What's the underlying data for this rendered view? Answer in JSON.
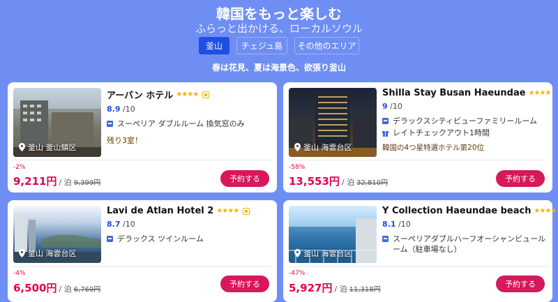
{
  "hero": {
    "title": "韓国をもっと楽しむ",
    "subtitle": "ふらっと出かける、ローカルソウル"
  },
  "tabs": [
    {
      "label": "釜山",
      "active": true
    },
    {
      "label": "チェジュ島",
      "active": false
    },
    {
      "label": "その他のエリア",
      "active": false
    }
  ],
  "tagline": "春は花見、夏は海景色、欲張り釜山",
  "colors": {
    "accent": "#1f4fe0",
    "price": "#e0004d",
    "button": "#d7185a",
    "background": "#6f8ef3",
    "star": "#f5b200"
  },
  "hotels": [
    {
      "name": "アーバン ホテル",
      "stars": "★★★★",
      "score": "8.9",
      "score_max": "/10",
      "location": "釜山 釜山鎮区",
      "features": [
        "スーペリア ダブルルーム 換気窓のみ"
      ],
      "feature_icons": [
        "bed-icon"
      ],
      "note": "残り3室！",
      "discount": "-2%",
      "price": "9,211円",
      "per_night": "/ 泊",
      "old_price": "9,399円",
      "book_label": "予約する"
    },
    {
      "name": "Shilla Stay Busan Haeundae",
      "stars": "★★★★",
      "score": "9",
      "score_max": "/10",
      "location": "釜山 海雲台区",
      "features": [
        "デラックスシティビューファミリールーム",
        "レイトチェックアウト1時間"
      ],
      "feature_icons": [
        "bed-icon",
        "gift-icon"
      ],
      "note": "韓国の4つ星特選ホテル第20位",
      "discount": "-58%",
      "price": "13,553円",
      "per_night": "/ 泊",
      "old_price": "32,810円",
      "book_label": "予約する"
    },
    {
      "name": "Lavi de Atlan Hotel 2",
      "stars": "★★★★",
      "score": "8.7",
      "score_max": "/10",
      "location": "釜山 海雲台区",
      "features": [
        "デラックス ツインルーム"
      ],
      "feature_icons": [
        "bed-icon"
      ],
      "note": "",
      "discount": "-4%",
      "price": "6,500円",
      "per_night": "/ 泊",
      "old_price": "6,769円",
      "book_label": "予約する"
    },
    {
      "name": "Y Collection Haeundae beach",
      "stars": "★★★★",
      "score": "8.1",
      "score_max": "/10",
      "location": "釜山 海雲台区",
      "features": [
        "スーペリアダブルハーフオーシャンビュールーム（駐車場なし）"
      ],
      "feature_icons": [
        "bed-icon"
      ],
      "note": "",
      "discount": "-47%",
      "price": "5,927円",
      "per_night": "/ 泊",
      "old_price": "11,318円",
      "book_label": "予約する"
    }
  ]
}
